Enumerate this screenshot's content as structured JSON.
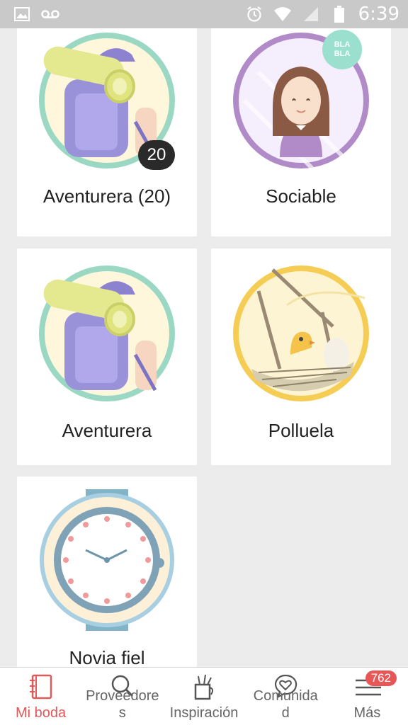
{
  "status_bar": {
    "time": "6:39",
    "left_icons": [
      "image-icon",
      "voicemail-icon"
    ],
    "right_icons": [
      "alarm-icon",
      "wifi-icon",
      "signal-icon",
      "battery-icon"
    ]
  },
  "badges": [
    {
      "title": "Aventurera (20)",
      "icon": "backpacker-icon",
      "count": "20"
    },
    {
      "title": "Sociable",
      "icon": "sociable-girl-icon",
      "bubble_line1": "BLA",
      "bubble_line2": "BLA"
    },
    {
      "title": "Aventurera",
      "icon": "backpacker-icon"
    },
    {
      "title": "Polluela",
      "icon": "chick-nest-icon"
    },
    {
      "title": "Novia fiel",
      "icon": "watch-icon"
    }
  ],
  "bottom_nav": {
    "items": [
      {
        "label": "Mi boda",
        "icon": "notebook-icon",
        "active": true
      },
      {
        "label": "Proveedore\ns",
        "icon": "search-icon"
      },
      {
        "label": "Inspiración",
        "icon": "brushes-icon"
      },
      {
        "label": "Comunida\nd",
        "icon": "heart-chat-icon"
      },
      {
        "label": "Más",
        "icon": "menu-icon",
        "badge": "762"
      }
    ]
  },
  "colors": {
    "active": "#e05a5a",
    "badge_red": "#e85757",
    "status_bar": "#c9c9c9"
  }
}
